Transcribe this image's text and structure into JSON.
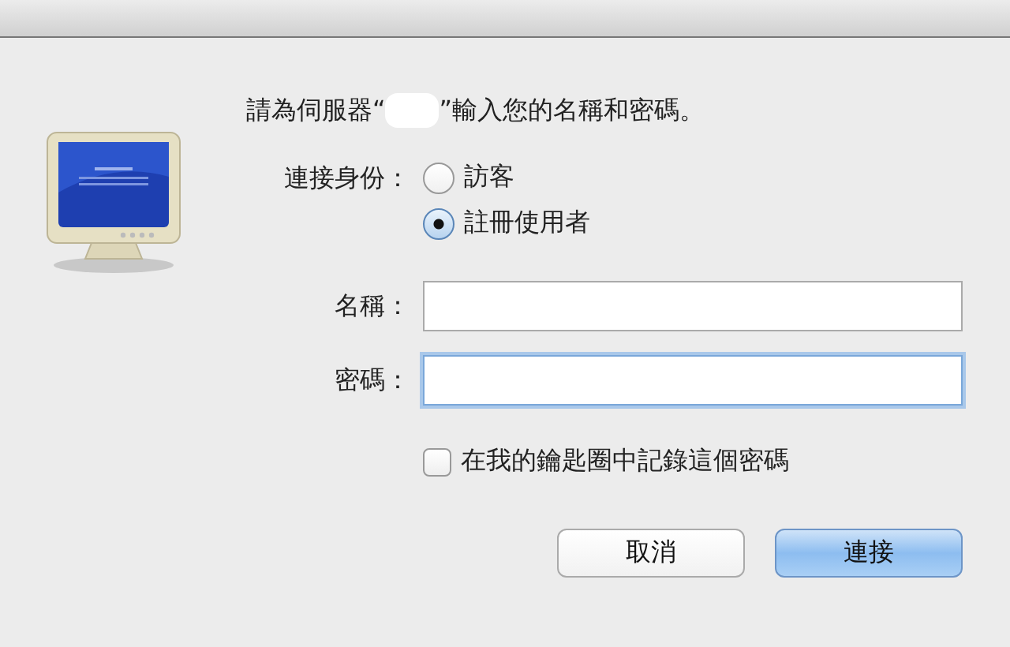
{
  "message": {
    "before": "請為伺服器“",
    "after": "”輸入您的名稱和密碼。"
  },
  "connect_as": {
    "label": "連接身份：",
    "options": [
      {
        "label": "訪客",
        "selected": false
      },
      {
        "label": "註冊使用者",
        "selected": true
      }
    ]
  },
  "fields": [
    {
      "label": "名稱：",
      "focused": false
    },
    {
      "label": "密碼：",
      "focused": true
    }
  ],
  "remember": {
    "label": "在我的鑰匙圈中記錄這個密碼",
    "checked": false
  },
  "buttons": [
    {
      "label": "取消",
      "default": false
    },
    {
      "label": "連接",
      "default": true
    }
  ]
}
